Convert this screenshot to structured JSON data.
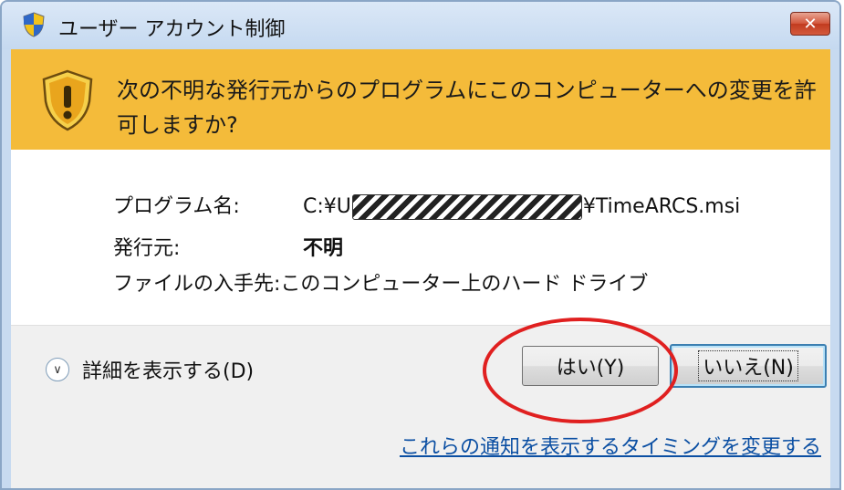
{
  "window": {
    "title": "ユーザー アカウント制御",
    "close_label": "✕"
  },
  "banner": {
    "message": "次の不明な発行元からのプログラムにこのコンピューターへの変更を許可しますか?"
  },
  "details": {
    "program_label": "プログラム名:",
    "program_prefix": "C:¥U",
    "program_suffix": "¥TimeARCS.msi",
    "publisher_label": "発行元:",
    "publisher_value": "不明",
    "source_label": "ファイルの入手先:",
    "source_value": "このコンピューター上のハード ドライブ"
  },
  "footer": {
    "show_details_label": "詳細を表示する(D)",
    "yes_label": "はい(Y)",
    "no_label": "いいえ(N)",
    "timing_link": "これらの通知を表示するタイミングを変更する"
  },
  "colors": {
    "banner": "#f4bb3a",
    "link": "#0b4fa3",
    "highlight": "#e02020"
  }
}
